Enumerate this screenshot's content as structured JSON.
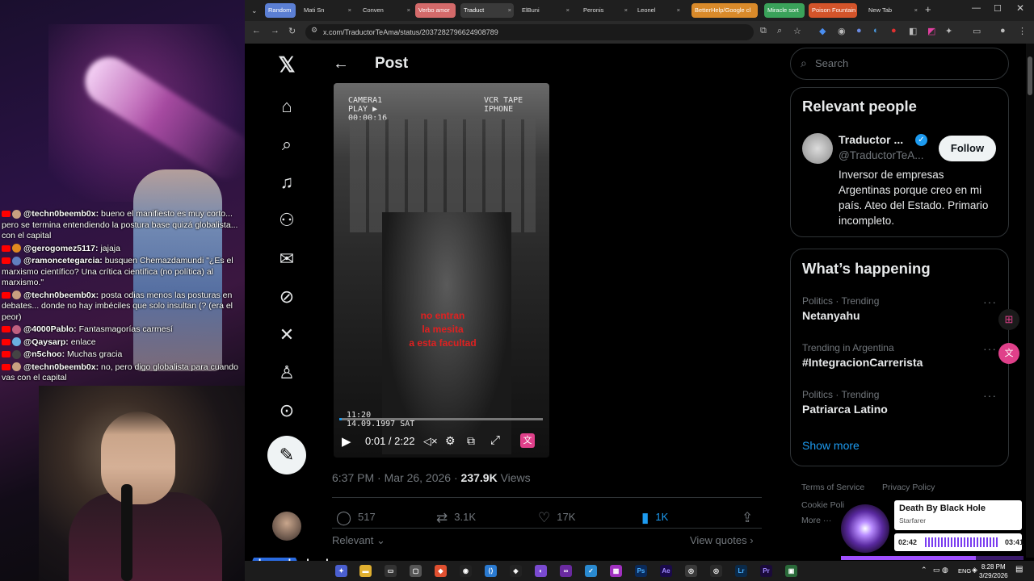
{
  "browser": {
    "tabs": [
      {
        "label": "Random",
        "color": "#5b7fd4"
      },
      {
        "label": "Mati Sn",
        "color": ""
      },
      {
        "label": "Conven",
        "color": ""
      },
      {
        "label": "Verbo amor",
        "color": "#d46a6a"
      },
      {
        "label": "Traduct",
        "color": "#3a3a3a"
      },
      {
        "label": "ElBuni",
        "color": ""
      },
      {
        "label": "Peronis",
        "color": ""
      },
      {
        "label": "Leonel",
        "color": ""
      },
      {
        "label": "BetterHelp/Google cl",
        "color": "#d98a2a"
      },
      {
        "label": "Miracle sort",
        "color": "#3aa25a"
      },
      {
        "label": "Poison Fountain",
        "color": "#d4542a"
      },
      {
        "label": "New Tab",
        "color": ""
      }
    ],
    "url": "x.com/TraductorTeAma/status/2037282796624908789"
  },
  "stream": {
    "chat": [
      {
        "user": "@techn0beemb0x:",
        "text": "bueno el manifiesto es muy corto... pero se termina entendiendo la postura base quizá globalista... con el capital",
        "avatar_color": "#c8a080"
      },
      {
        "user": "@gerogomez5117:",
        "text": "jajaja",
        "avatar_color": "#e08a20"
      },
      {
        "user": "@ramoncetegarcia:",
        "text": "busquen Chemazdamundi \"¿Es el marxismo científico? Una crítica científica (no política) al marxismo.\"",
        "avatar_color": "#6080c0"
      },
      {
        "user": "@techn0beemb0x:",
        "text": "posta odias menos las posturas en debates... donde no hay imbéciles que solo insultan (? (era el peor)",
        "avatar_color": "#c8a080"
      },
      {
        "user": "@4000Pablo:",
        "text": "Fantasmagorías carmesí",
        "avatar_color": "#c06080"
      },
      {
        "user": "@Qaysarp:",
        "text": "enlace",
        "avatar_color": "#6ab0e0"
      },
      {
        "user": "@n5choo:",
        "text": "Muchas gracia",
        "avatar_color": "#444"
      },
      {
        "user": "@techn0beemb0x:",
        "text": "no, pero digo globalista para cuando vas con el capital",
        "avatar_color": "#c8a080"
      }
    ],
    "sponsor": {
      "brand": "donweb",
      "suffix": "cloud"
    }
  },
  "x": {
    "page_title": "Post",
    "video": {
      "overlay_tl": "CAMERA1\nPLAY ▶\n00:00:16",
      "overlay_tr": "VCR TAPE\nIPHONE",
      "caption_red": "no entran\nla mesita\na esta facultad",
      "timestamp_bl": "11:20\n14.09.1997 SAT",
      "time": "0:01 / 2:22",
      "progress": 0.008
    },
    "post_meta": {
      "time": "6:37 PM · Mar 26, 2026 · ",
      "views_count": "237.9K",
      "views_label": " Views"
    },
    "actions": {
      "replies": "517",
      "reposts": "3.1K",
      "likes": "17K",
      "bookmarks": "1K"
    },
    "relevant": "Relevant",
    "view_quotes": "View quotes",
    "search_placeholder": "Search",
    "relevant_people": {
      "title": "Relevant people",
      "name": "Traductor ...",
      "handle": "@TraductorTeA...",
      "follow": "Follow",
      "bio": "Inversor de empresas Argentinas porque creo en mi país. Ateo del Estado. Primario incompleto."
    },
    "happening": {
      "title": "What’s happening",
      "trends": [
        {
          "context": "Politics · Trending",
          "name": "Netanyahu"
        },
        {
          "context": "Trending in Argentina",
          "name": "#IntegracionCarrerista"
        },
        {
          "context": "Politics · Trending",
          "name": "Patriarca Latino"
        }
      ],
      "show_more": "Show more"
    },
    "footer": {
      "terms": "Terms of Service",
      "privacy": "Privacy Policy",
      "cookie": "Cookie Poli",
      "more": "More ···"
    }
  },
  "music": {
    "title": "Death By Black Hole",
    "artist": "Starfarer",
    "elapsed": "02:42",
    "total": "03:41",
    "progress": 0.74
  },
  "taskbar": {
    "lang": "ENG",
    "time": "8:28 PM",
    "date": "3/29/2026"
  }
}
